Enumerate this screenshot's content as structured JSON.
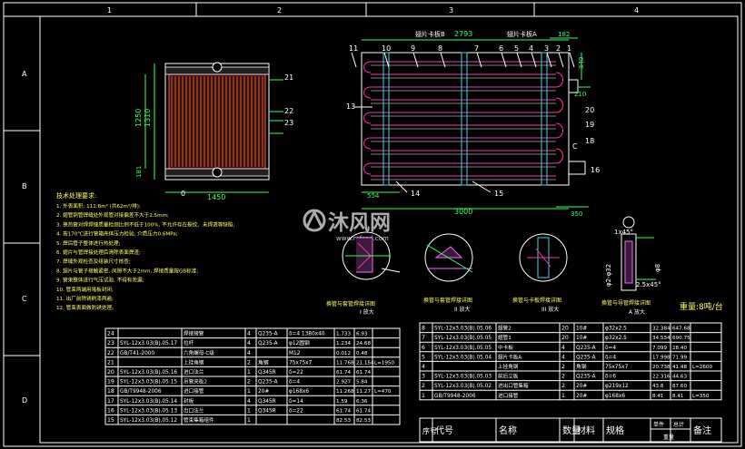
{
  "frame": {
    "zone_letters": [
      "A",
      "B",
      "C",
      "D"
    ],
    "zone_numbers": [
      "1",
      "2",
      "3",
      "4",
      "5",
      "6"
    ]
  },
  "front_view": {
    "dims": [
      "1310",
      "1250",
      "1450",
      "181"
    ],
    "callouts": [
      "0",
      "21",
      "22",
      "23"
    ]
  },
  "side_view": {
    "dims": [
      "2793",
      "554",
      "3000",
      "350",
      "182",
      "210",
      "340"
    ],
    "callouts_top": [
      "11",
      "10",
      "9",
      "8",
      "7",
      "6",
      "5",
      "4",
      "3",
      "2",
      "1"
    ],
    "callouts_right": [
      "20",
      "19",
      "18",
      "16",
      "C"
    ],
    "callouts_left": [
      "13",
      "14"
    ],
    "callouts_bottom": [
      "15"
    ],
    "top_labels": [
      "翅片卡板B",
      "翅片卡板A"
    ]
  },
  "tech_req": {
    "title": "技术处理要求:",
    "lines": [
      "1. 外表面积: 111.6m² (共62m²/排);",
      "2. 翅管铜管焊缝处外观管对接偏差不大于2.5mm;",
      "3. 换热管对焊焊缝质量检测比例不低于100%, 不允许存在裂纹、未焊透等缺陷;",
      "4. 按170℃进行管箱壳体压力检验, 介质压力0.6MPa;",
      "5. 焊后管子整体进行热处理;",
      "6. 翅片与管焊接处理后清除表面焊渣;",
      "7. 焊缝外观检查及组装尺寸核查;",
      "8. 翅片与管子接触紧密, 间隙不大于2mm, 焊接质量按GB标准;",
      "9. 管束整体进行气压试验, 不得有泄漏;",
      "10. 管束两端用堵板封闭;",
      "11. 出厂前除锈刷漆两遍;",
      "12. 管束表面做防锈处理。"
    ]
  },
  "details": [
    {
      "title": "换管与套管焊接详图",
      "sub": "I 放大"
    },
    {
      "title": "换管与套管焊接详图",
      "sub": "II 放大"
    },
    {
      "title": "换管与卡板焊接详图",
      "sub": "III 放大"
    },
    {
      "title": "换管与导管焊接详图",
      "sub": "A 放大"
    }
  ],
  "detail_dims": [
    "1x45°",
    "2.5x45°",
    "φ2-φ32",
    "φ8"
  ],
  "weight_note": "重量:8吨/台",
  "watermark": {
    "brand": "沐风网",
    "url": "www.mfcad.com"
  },
  "bom_left": [
    {
      "no": "24",
      "code": "",
      "name": "焊接接管",
      "qty": "4",
      "mat": "Q235-A",
      "spec": "δ=4  1380x40",
      "w1": "1.733",
      "w2": "6.93",
      "note": ""
    },
    {
      "no": "23",
      "code": "SYL-12x3.03(B).05.17",
      "name": "拉杆",
      "qty": "4",
      "mat": "Q235-A",
      "spec": "φ12圆钢",
      "w1": "1.234",
      "w2": "24.68",
      "note": ""
    },
    {
      "no": "22",
      "code": "GB/T41-2000",
      "name": "六角螺母-C级",
      "qty": "4",
      "mat": "",
      "spec": "M12",
      "w1": "0.012",
      "w2": "0.48",
      "note": ""
    },
    {
      "no": "21",
      "code": "",
      "name": "上挂角钢",
      "qty": "2",
      "mat": "角钢",
      "spec": "75x75x7",
      "w1": "11.768",
      "w2": "21.154",
      "note": "L=1950"
    },
    {
      "no": "20",
      "code": "SYL-12x3.03(B).05.16",
      "name": "进口法兰",
      "qty": "1",
      "mat": "Q345R",
      "spec": "δ=22",
      "w1": "61.74",
      "w2": "61.74",
      "note": ""
    },
    {
      "no": "19",
      "code": "SYL-12x3.03(B).05.15",
      "name": "吊管夹板2",
      "qty": "2",
      "mat": "Q235-A",
      "spec": "δ=4",
      "w1": "2.927",
      "w2": "5.84",
      "note": ""
    },
    {
      "no": "18",
      "code": "GB/T9948-2006",
      "name": "进口接管",
      "qty": "1",
      "mat": "20#",
      "spec": "φ168x6",
      "w1": "11.268",
      "w2": "11.27",
      "note": "L=470"
    },
    {
      "no": "17",
      "code": "SYL-12x3.03(B).05.14",
      "name": "封板",
      "qty": "4",
      "mat": "Q345R",
      "spec": "δ=14",
      "w1": "1.59",
      "w2": "6.36",
      "note": ""
    },
    {
      "no": "16",
      "code": "SYL-12x3.03(B).05.13",
      "name": "出口法兰",
      "qty": "1",
      "mat": "Q345R",
      "spec": "δ=22",
      "w1": "61.74",
      "w2": "61.74",
      "note": ""
    },
    {
      "no": "15",
      "code": "SYL-12x3.03(B).05.12",
      "name": "管束集箱组件",
      "qty": "1",
      "mat": "",
      "spec": "",
      "w1": "82.53",
      "w2": "82.53",
      "note": ""
    }
  ],
  "bom_right": [
    {
      "no": "8",
      "code": "SYL-12x3.03(B).05.06",
      "name": "翅管2",
      "qty": "20",
      "mat": "10#",
      "spec": "φ32x2.5",
      "w1": "32.384",
      "w2": "647.68",
      "note": ""
    },
    {
      "no": "7",
      "code": "SYL-12x3.03(B).05.05",
      "name": "翅管1",
      "qty": "20",
      "mat": "10#",
      "spec": "φ32x2.5",
      "w1": "34.534",
      "w2": "690.75",
      "note": ""
    },
    {
      "no": "6",
      "code": "SYL-12x3.03(B).05.05",
      "name": "中卡板",
      "qty": "4",
      "mat": "Q235-A",
      "spec": "δ=4",
      "w1": "7.099",
      "w2": "28.40",
      "note": ""
    },
    {
      "no": "5",
      "code": "SYL-12x3.03(B).05.04",
      "name": "翅片卡板A",
      "qty": "4",
      "mat": "Q235-A",
      "spec": "δ=4",
      "w1": "17.998",
      "w2": "71.99",
      "note": ""
    },
    {
      "no": "4",
      "code": "",
      "name": "上挂角钢",
      "qty": "2",
      "mat": "角钢",
      "spec": "75x75x7",
      "w1": "20.738",
      "w2": "41.48",
      "note": "L=2600"
    },
    {
      "no": "3",
      "code": "SYL-12x3.03(B).05.03",
      "name": "前后立板",
      "qty": "2",
      "mat": "Q235-A",
      "spec": "δ=6",
      "w1": "22.316",
      "w2": "44.63",
      "note": ""
    },
    {
      "no": "2",
      "code": "SYL-12x3.03(B).05.02",
      "name": "进出口管集箱",
      "qty": "2",
      "mat": "20#",
      "spec": "φ219x12",
      "w1": "43.8",
      "w2": "87.60",
      "note": ""
    },
    {
      "no": "1",
      "code": "GB/T9948-2006",
      "name": "进口接管",
      "qty": "1",
      "mat": "20#",
      "spec": "φ168x6",
      "w1": "8.41",
      "w2": "8.41",
      "note": "L=350"
    }
  ],
  "bom_header": {
    "no": "序号",
    "code": "代号",
    "name": "名称",
    "qty": "数量",
    "mat": "材料",
    "spec": "规格",
    "w1": "单件",
    "w2": "总计",
    "wt": "重量",
    "note": "备注"
  }
}
